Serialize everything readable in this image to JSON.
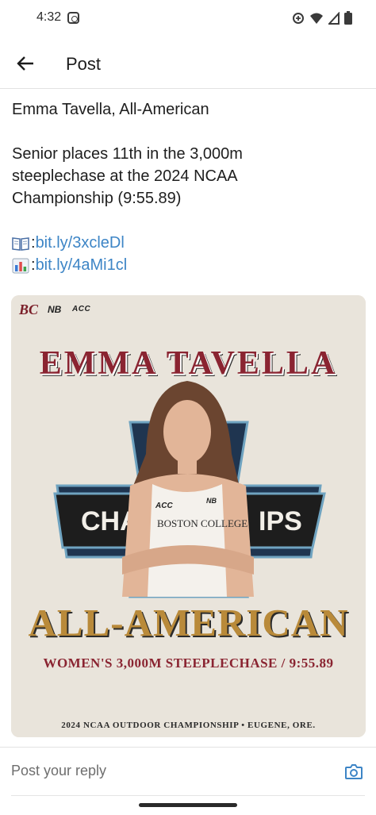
{
  "status_bar": {
    "time": "4:32",
    "icons": [
      "instagram-icon",
      "data-saver-icon",
      "wifi-icon",
      "signal-icon",
      "battery-icon"
    ]
  },
  "app_bar": {
    "title": "Post",
    "back_icon": "arrow-left-icon"
  },
  "post": {
    "title_line": "Emma Tavella, All-American",
    "body_lines": [
      "Senior places 11th in the 3,000m",
      "steeplechase at the 2024 NCAA",
      "Championship (9:55.89)"
    ],
    "links": [
      {
        "emoji": "book-emoji",
        "prefix": ": ",
        "url": "bit.ly/3xcleDl"
      },
      {
        "emoji": "bar-chart-emoji",
        "prefix": ": ",
        "url": "bit.ly/4aMi1cl"
      }
    ]
  },
  "graphic": {
    "logos": [
      "BC",
      "NB",
      "ACC"
    ],
    "athlete_name": "EMMA TAVELLA",
    "award": "ALL-AMERICAN",
    "event": "WOMEN'S 3,000M STEEPLECHASE / 9:55.89",
    "meet": "2024 NCAA OUTDOOR CHAMPIONSHIP • EUGENE, ORE.",
    "banner_left": "CHA",
    "banner_right": "IPS",
    "jersey_school": "BOSTON COLLEGE",
    "jersey_acc": "ACC",
    "jersey_nb": "NB"
  },
  "reply": {
    "placeholder": "Post your reply",
    "camera_icon": "camera-icon"
  },
  "colors": {
    "link": "#3d85c6",
    "maroon": "#8a2431",
    "gold": "#b98a3a",
    "navy": "#1f3550"
  }
}
